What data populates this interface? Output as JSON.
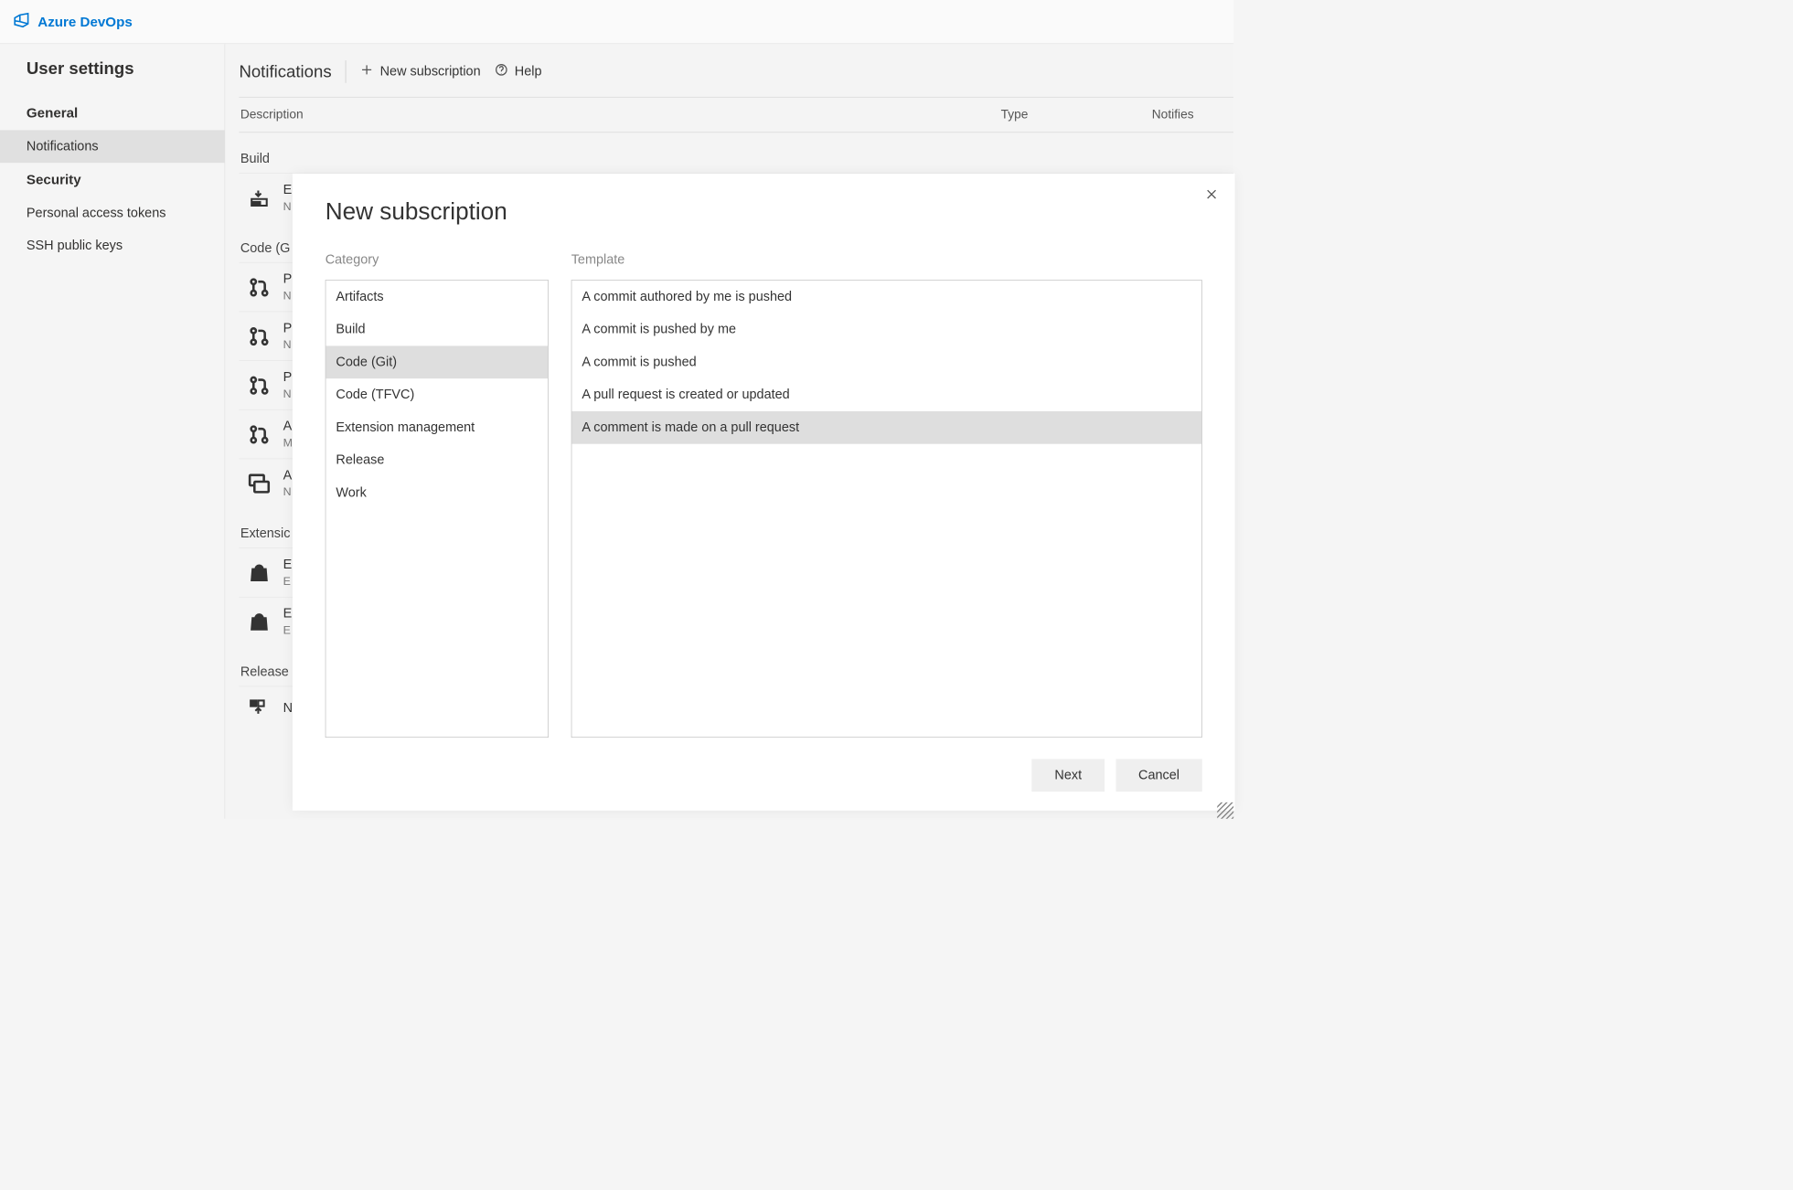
{
  "header": {
    "brand": "Azure DevOps"
  },
  "sidebar": {
    "title": "User settings",
    "sections": [
      {
        "header": "General",
        "items": [
          "Notifications"
        ],
        "activeIndex": 0
      },
      {
        "header": "Security",
        "items": [
          "Personal access tokens",
          "SSH public keys"
        ]
      }
    ]
  },
  "page": {
    "title": "Notifications",
    "new_subscription_label": "New subscription",
    "help_label": "Help",
    "columns": {
      "description": "Description",
      "type": "Type",
      "notifies": "Notifies"
    },
    "groups": [
      {
        "label": "Build",
        "rows": [
          {
            "icon": "build",
            "main": "E",
            "sub": "N"
          }
        ]
      },
      {
        "label": "Code (G",
        "rows": [
          {
            "icon": "pr",
            "main": "P",
            "sub": "N"
          },
          {
            "icon": "pr",
            "main": "P",
            "sub": "N"
          },
          {
            "icon": "pr",
            "main": "P",
            "sub": "N"
          },
          {
            "icon": "pr",
            "main": "A",
            "sub": "M"
          },
          {
            "icon": "comment",
            "main": "A",
            "sub": "N"
          }
        ]
      },
      {
        "label": "Extensic",
        "rows": [
          {
            "icon": "bag",
            "main": "E",
            "sub": "E"
          },
          {
            "icon": "bag",
            "main": "E",
            "sub": "E"
          }
        ]
      },
      {
        "label": "Release",
        "rows": [
          {
            "icon": "release",
            "main": "N",
            "sub": ""
          }
        ]
      }
    ]
  },
  "modal": {
    "title": "New subscription",
    "category_label": "Category",
    "template_label": "Template",
    "categories": [
      "Artifacts",
      "Build",
      "Code (Git)",
      "Code (TFVC)",
      "Extension management",
      "Release",
      "Work"
    ],
    "category_selected_index": 2,
    "templates": [
      "A commit authored by me is pushed",
      "A commit is pushed by me",
      "A commit is pushed",
      "A pull request is created or updated",
      "A comment is made on a pull request"
    ],
    "template_selected_index": 4,
    "next_label": "Next",
    "cancel_label": "Cancel"
  }
}
